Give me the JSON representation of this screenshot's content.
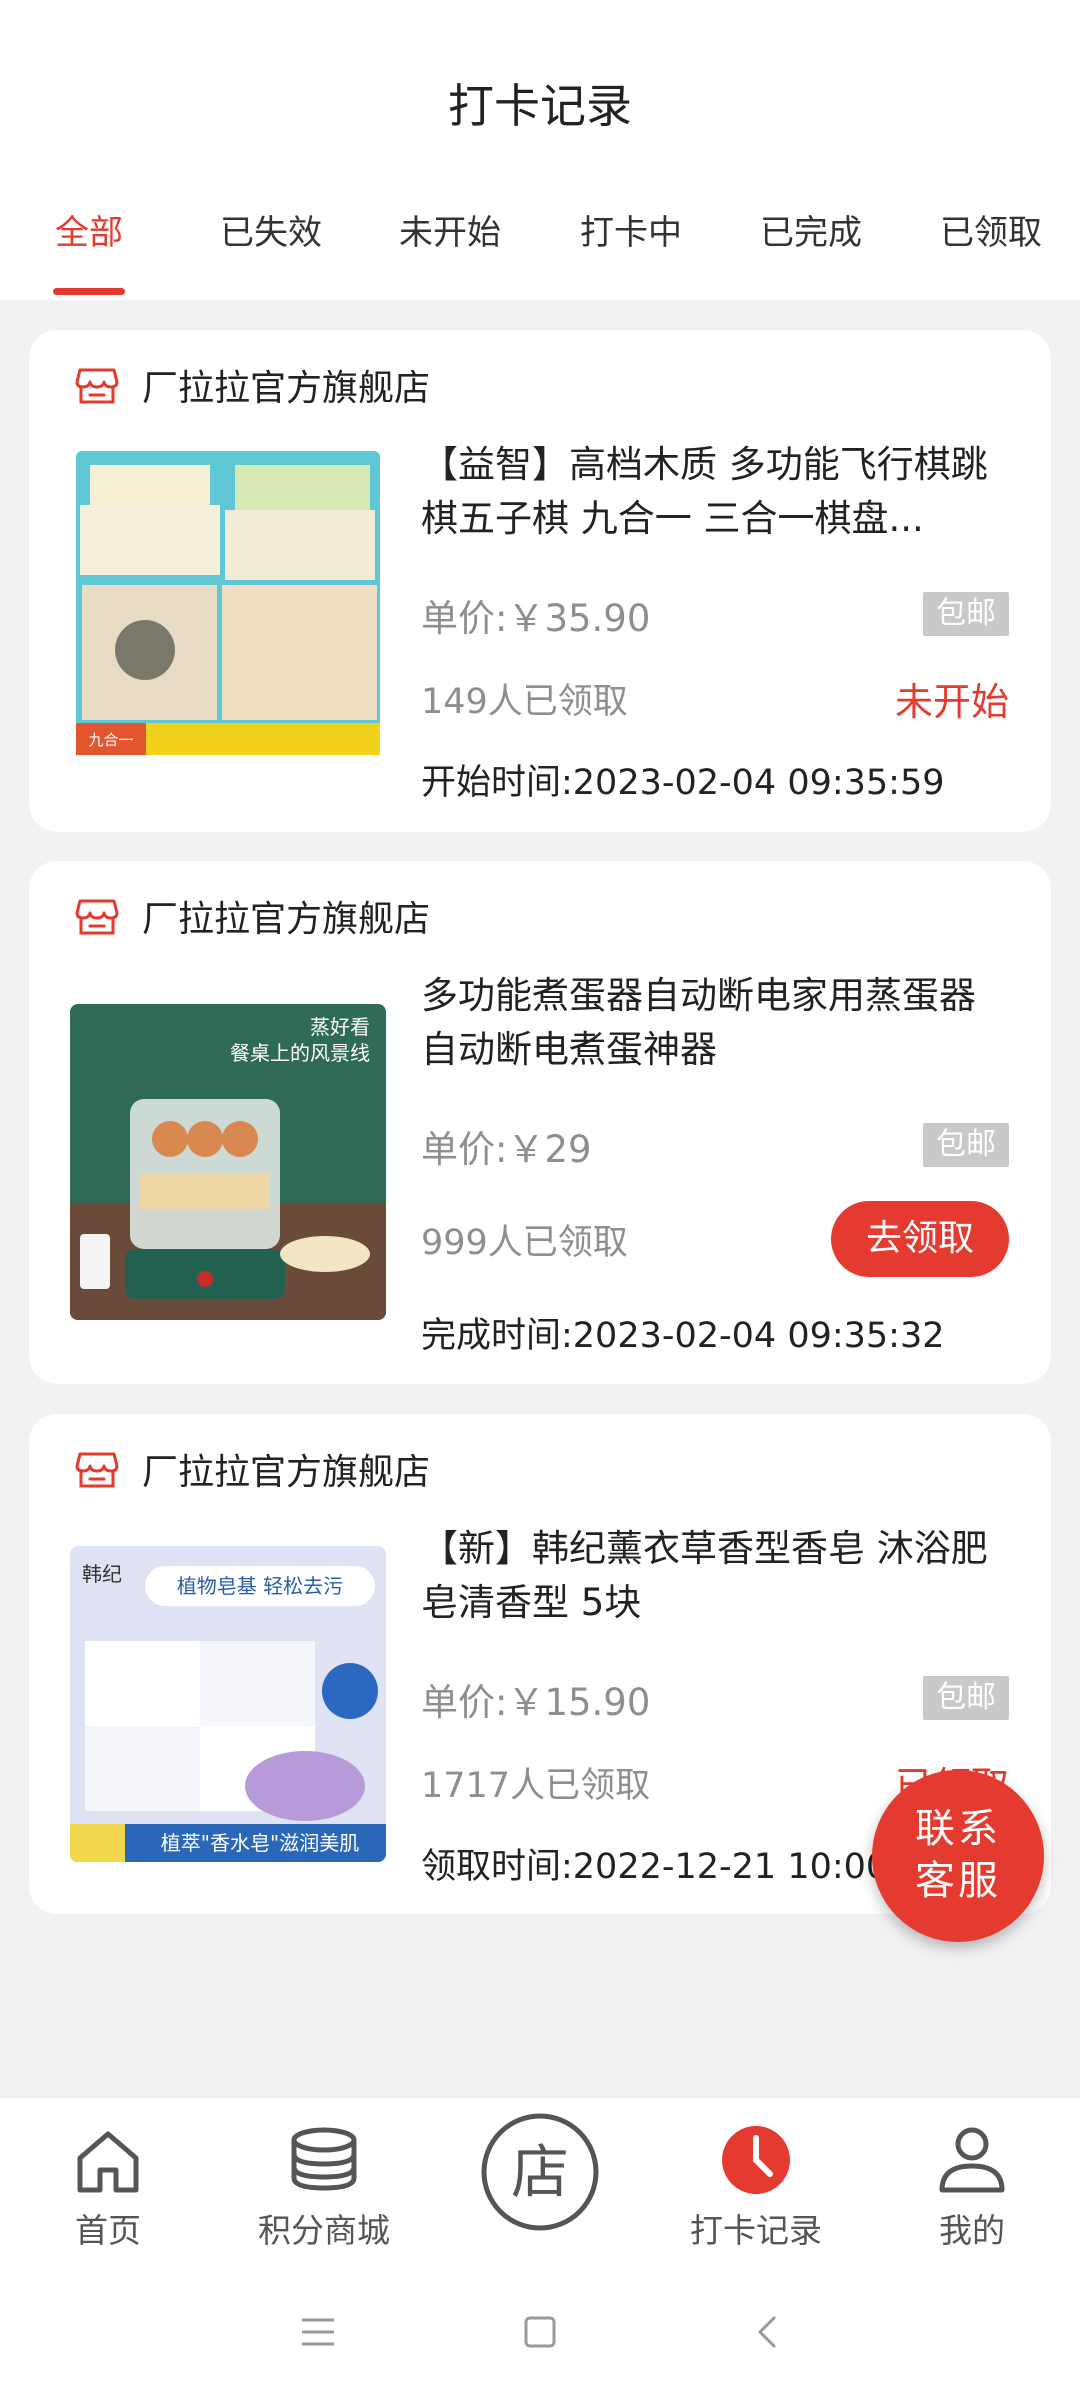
{
  "header": {
    "title": "打卡记录"
  },
  "tabs": [
    {
      "label": "全部"
    },
    {
      "label": "已失效"
    },
    {
      "label": "未开始"
    },
    {
      "label": "打卡中"
    },
    {
      "label": "已完成"
    },
    {
      "label": "已领取"
    }
  ],
  "cards": [
    {
      "store": "厂拉拉官方旗舰店",
      "name": "【益智】高档木质 多功能飞行棋跳棋五子棋 九合一 三合一棋盘...",
      "price": "单价:￥35.90",
      "badge": "包邮",
      "claimed": "149人已领取",
      "status": "未开始",
      "time": "开始时间:2023-02-04 09:35:59"
    },
    {
      "store": "厂拉拉官方旗舰店",
      "name": "多功能煮蛋器自动断电家用蒸蛋器 自动断电煮蛋神器",
      "price": "单价:￥29",
      "badge": "包邮",
      "claimed": "999人已领取",
      "action": "去领取",
      "time": "完成时间:2023-02-04 09:35:32"
    },
    {
      "store": "厂拉拉官方旗舰店",
      "name": "【新】韩纪薰衣草香型香皂 沐浴肥皂清香型 5块",
      "price": "单价:￥15.90",
      "badge": "包邮",
      "claimed": "1717人已领取",
      "status": "已领取",
      "time": "领取时间:2022-12-21 10:00"
    }
  ],
  "fab": {
    "line1": "联系",
    "line2": "客服"
  },
  "nav": [
    {
      "label": "首页",
      "icon": "home-icon"
    },
    {
      "label": "积分商城",
      "icon": "coins-icon"
    },
    {
      "label": "",
      "icon": "store-icon"
    },
    {
      "label": "打卡记录",
      "icon": "clock-icon"
    },
    {
      "label": "我的",
      "icon": "user-icon"
    }
  ],
  "colors": {
    "accent": "#e53a2f",
    "background": "#f2f2f4",
    "badge": "#c9c9c9"
  }
}
